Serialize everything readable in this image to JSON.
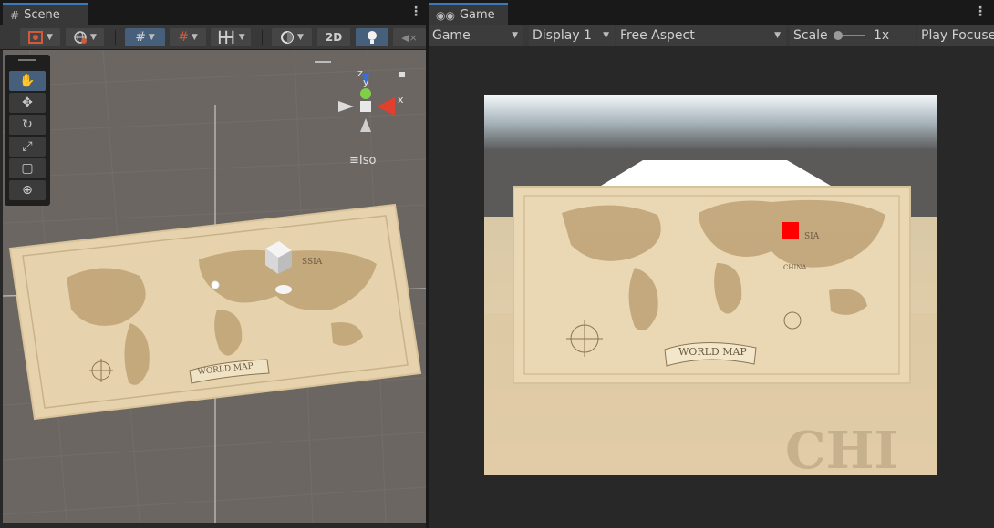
{
  "scene": {
    "tab_title": "Scene",
    "toolbar": {
      "btn_2d": "2D"
    },
    "gizmo": {
      "axis_x": "x",
      "axis_y": "y",
      "axis_z": "z"
    },
    "projection_label": "Iso",
    "map": {
      "title": "WORLD MAP",
      "region_label": "SSIA"
    }
  },
  "game": {
    "tab_title": "Game",
    "mode_select": "Game",
    "display_select": "Display 1",
    "aspect_select": "Free Aspect",
    "scale_label": "Scale",
    "scale_value": "1x",
    "play_focus": "Play Focuse",
    "map": {
      "title": "WORLD MAP",
      "region_label": "SIA",
      "china_label": "CHINA",
      "bg_text": "CHI"
    }
  },
  "colors": {
    "accent": "#3a79bb",
    "active_tool": "#46607c",
    "map_parchment": "#e8d6b2",
    "marker": "#ff0000"
  },
  "icons": [
    "hash-icon",
    "kebab-icon",
    "gamepad-icon",
    "hand-tool-icon",
    "move-tool-icon",
    "rotate-tool-icon",
    "scale-tool-icon",
    "rect-tool-icon",
    "transform-tool-icon",
    "lightbulb-icon",
    "audio-mute-icon"
  ]
}
